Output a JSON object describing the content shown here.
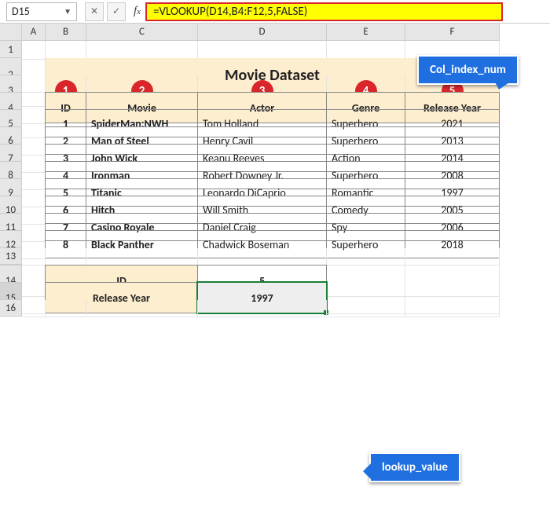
{
  "namebox": "D15",
  "formula": "=VLOOKUP(D14,B4:F12,5,FALSE)",
  "columns": [
    "A",
    "B",
    "C",
    "D",
    "E",
    "F"
  ],
  "rows": [
    "1",
    "2",
    "3",
    "4",
    "5",
    "6",
    "7",
    "8",
    "9",
    "10",
    "11",
    "12",
    "13",
    "14",
    "15",
    "16"
  ],
  "title": "Movie Dataset",
  "badges": [
    "1",
    "2",
    "3",
    "4",
    "5"
  ],
  "headers": {
    "id": "ID",
    "movie": "Movie",
    "actor": "Actor",
    "genre": "Genre",
    "year": "Release Year"
  },
  "data": [
    {
      "id": "1",
      "movie": "SpiderMan:NWH",
      "actor": "Tom Holland",
      "genre": "Superhero",
      "year": "2021"
    },
    {
      "id": "2",
      "movie": "Man of Steel",
      "actor": "Henry Cavil",
      "genre": "Superhero",
      "year": "2013"
    },
    {
      "id": "3",
      "movie": "John Wick",
      "actor": "Keanu Reeves",
      "genre": "Action",
      "year": "2014"
    },
    {
      "id": "4",
      "movie": "Ironman",
      "actor": "Robert Downey Jr.",
      "genre": "Superhero",
      "year": "2008"
    },
    {
      "id": "5",
      "movie": "Titanic",
      "actor": "Leonardo DiCaprio",
      "genre": "Romantic",
      "year": "1997"
    },
    {
      "id": "6",
      "movie": "Hitch",
      "actor": "Will Smith",
      "genre": "Comedy",
      "year": "2005"
    },
    {
      "id": "7",
      "movie": "Casino Royale",
      "actor": "Daniel Craig",
      "genre": "Spy",
      "year": "2006"
    },
    {
      "id": "8",
      "movie": "Black Panther",
      "actor": "Chadwick Boseman",
      "genre": "Superhero",
      "year": "2018"
    }
  ],
  "lookup": {
    "id_label": "ID",
    "id_value": "5",
    "year_label": "Release Year",
    "year_value": "1997"
  },
  "callouts": {
    "colindex": "Col_index_num",
    "lookupval": "lookup_value"
  }
}
